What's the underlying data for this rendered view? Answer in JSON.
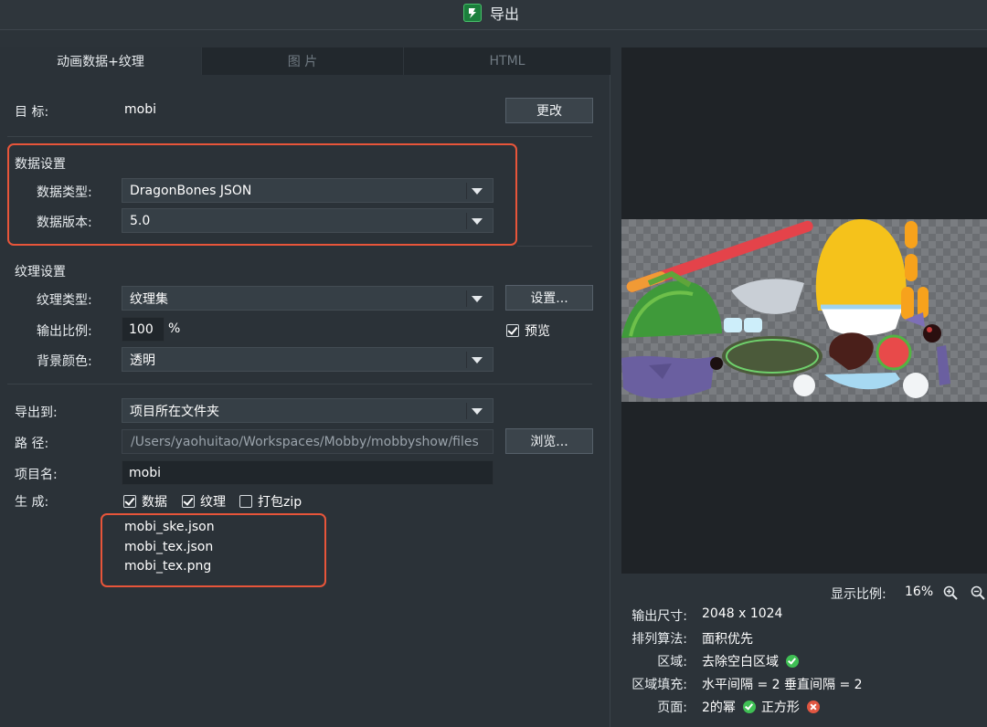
{
  "window": {
    "title": "导出"
  },
  "tabs": [
    {
      "label": "动画数据+纹理",
      "active": true
    },
    {
      "label": "图 片",
      "active": false
    },
    {
      "label": "HTML",
      "active": false
    }
  ],
  "target": {
    "label": "目 标:",
    "value": "mobi",
    "change_button": "更改"
  },
  "data_settings": {
    "heading": "数据设置",
    "data_type_label": "数据类型:",
    "data_type_value": "DragonBones JSON",
    "data_version_label": "数据版本:",
    "data_version_value": "5.0"
  },
  "texture_settings": {
    "heading": "纹理设置",
    "texture_type_label": "纹理类型:",
    "texture_type_value": "纹理集",
    "settings_button": "设置...",
    "scale_label": "输出比例:",
    "scale_value": "100",
    "scale_unit": "%",
    "preview_label": "预览",
    "preview_checked": true,
    "bg_color_label": "背景颜色:",
    "bg_color_value": "透明"
  },
  "export": {
    "export_to_label": "导出到:",
    "export_to_value": "项目所在文件夹",
    "path_label": "路 径:",
    "path_value": "/Users/yaohuitao/Workspaces/Mobby/mobbyshow/files",
    "browse_button": "浏览...",
    "project_name_label": "项目名:",
    "project_name_value": "mobi",
    "generate_label": "生 成:",
    "generate_options": [
      {
        "label": "数据",
        "checked": true
      },
      {
        "label": "纹理",
        "checked": true
      },
      {
        "label": "打包zip",
        "checked": false
      }
    ],
    "files": [
      "mobi_ske.json",
      "mobi_tex.json",
      "mobi_tex.png"
    ]
  },
  "preview_info": {
    "zoom_label": "显示比例:",
    "zoom_value": "16%",
    "output_size_label": "输出尺寸:",
    "output_size_value": "2048 x 1024",
    "algorithm_label": "排列算法:",
    "algorithm_value": "面积优先",
    "region_label": "区域:",
    "region_value": "去除空白区域",
    "padding_label": "区域填充:",
    "padding_value": "水平间隔 = 2 垂直间隔 = 2",
    "page_label": "页面:",
    "page_value_a": "2的幂",
    "page_value_b": "正方形"
  },
  "colors": {
    "highlight": "#e8553a",
    "ok": "#3fbf54",
    "error": "#e05641"
  }
}
